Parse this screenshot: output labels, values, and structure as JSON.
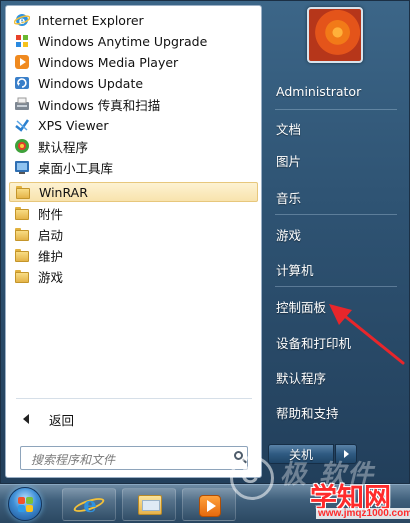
{
  "programs": [
    {
      "label": "Internet Explorer",
      "icon": "internet-explorer-icon"
    },
    {
      "label": "Windows Anytime Upgrade",
      "icon": "windows-anytime-upgrade-icon"
    },
    {
      "label": "Windows Media Player",
      "icon": "windows-media-player-icon"
    },
    {
      "label": "Windows Update",
      "icon": "windows-update-icon"
    },
    {
      "label": "Windows 传真和扫描",
      "icon": "fax-scan-icon"
    },
    {
      "label": "XPS Viewer",
      "icon": "xps-viewer-icon"
    },
    {
      "label": "默认程序",
      "icon": "default-programs-icon"
    },
    {
      "label": "桌面小工具库",
      "icon": "gadgets-icon"
    },
    {
      "label": "WinRAR",
      "icon": "folder-icon",
      "selected": true
    },
    {
      "label": "附件",
      "icon": "folder-icon"
    },
    {
      "label": "启动",
      "icon": "folder-icon"
    },
    {
      "label": "维护",
      "icon": "folder-icon"
    },
    {
      "label": "游戏",
      "icon": "folder-icon"
    }
  ],
  "back_label": "返回",
  "search": {
    "placeholder": "搜索程序和文件"
  },
  "right_menu": {
    "user": "Administrator",
    "items": [
      "文档",
      "图片",
      "音乐",
      "游戏",
      "计算机",
      "控制面板",
      "设备和打印机",
      "默认程序",
      "帮助和支持"
    ]
  },
  "shutdown_label": "关机",
  "watermark": {
    "faded_text": "极 软件",
    "site": "学知网",
    "url": "www.jmqz1000.com"
  },
  "colors": {
    "selected_highlight": "#f8e3ad",
    "annotation_arrow": "#e8262b",
    "menu_right_pane": "#2f5474"
  }
}
